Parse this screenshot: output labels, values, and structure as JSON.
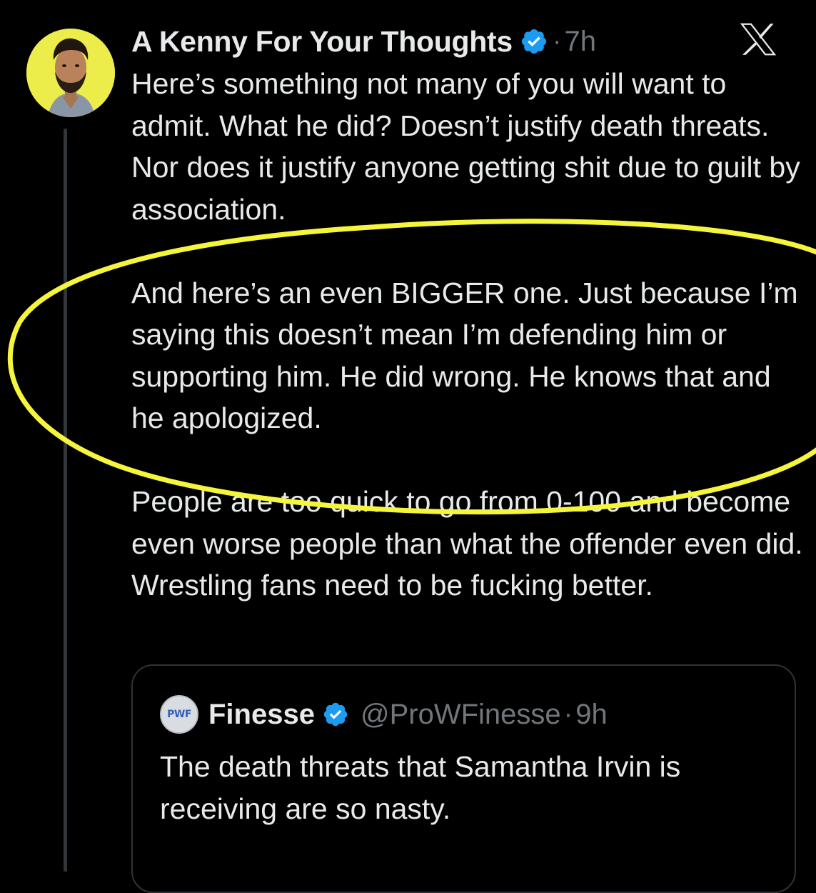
{
  "tweet": {
    "author_name": "A Kenny For Your Thoughts",
    "separator": "·",
    "time": "7h",
    "paragraphs": [
      "Here’s something not many of you will want to admit. What he did? Doesn’t justify death threats. Nor does it justify anyone getting shit due to guilt by association.",
      "And here’s an even BIGGER one. Just because I’m saying this doesn’t mean I’m defending him or supporting him. He did wrong. He knows that and he apologized.",
      "People are too quick to go from 0-100 and become even worse people than what the offender even did. Wrestling fans need to be fucking better."
    ]
  },
  "quoted_tweet": {
    "avatar_text": "PWF",
    "author_name": "Finesse",
    "handle": "@ProWFinesse",
    "separator": "·",
    "time": "9h",
    "text": "The death threats that Samantha Irvin is receiving are so nasty."
  },
  "icons": {
    "verified": "verified-badge-icon",
    "brand": "x-logo-icon"
  },
  "colors": {
    "background": "#000000",
    "text_primary": "#e7e9ea",
    "text_secondary": "#71767b",
    "verified_blue": "#1d9bf0",
    "highlight_yellow": "#f5f53c",
    "avatar_bg": "#ecec4a"
  }
}
